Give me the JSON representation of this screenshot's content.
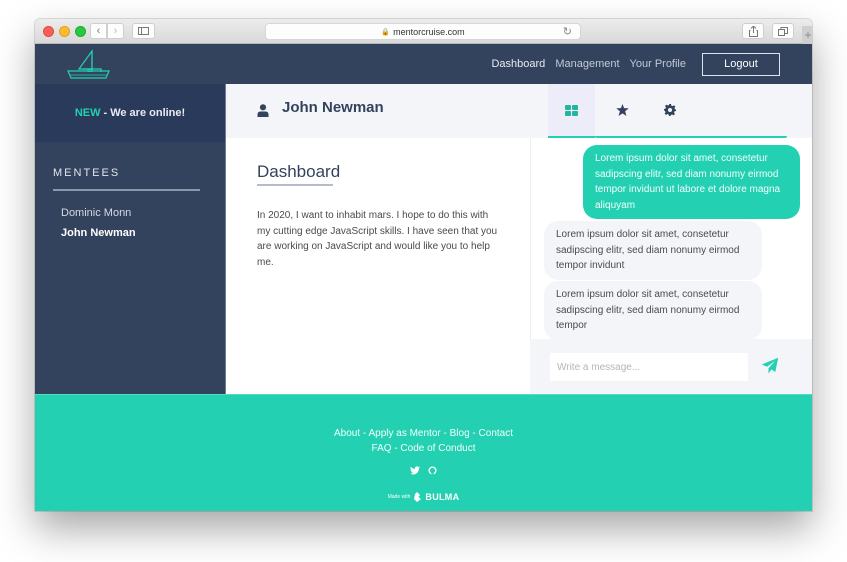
{
  "browser": {
    "url": "mentorcruise.com",
    "icons": [
      "back-icon",
      "forward-icon",
      "sidebar-icon",
      "lock-icon",
      "reload-icon",
      "share-icon",
      "tabs-icon",
      "new-tab-icon"
    ]
  },
  "navbar": {
    "logo": "sailboat-logo",
    "links": [
      "Dashboard",
      "Management",
      "Your Profile"
    ],
    "logout_label": "Logout"
  },
  "sidebar": {
    "banner_new": "NEW",
    "banner_text": " - We are online!",
    "section_title": "MENTEES",
    "mentees": [
      "Dominic Monn",
      "John Newman"
    ],
    "active_mentee": "John Newman"
  },
  "main": {
    "user_name": "John Newman",
    "section_title": "Dashboard",
    "description": "In 2020, I want to inhabit mars. I hope to do this with my cutting edge JavaScript skills. I have seen that you are working on JavaScript and would like you to help me."
  },
  "chat": {
    "tabs": [
      {
        "icon": "dashboard-icon",
        "active": true
      },
      {
        "icon": "star-icon",
        "active": false
      },
      {
        "icon": "gear-icon",
        "active": false
      }
    ],
    "messages": [
      {
        "direction": "outgoing",
        "text": "Lorem ipsum dolor sit amet, consetetur sadipscing elitr, sed diam nonumy eirmod tempor invidunt ut labore et dolore magna aliquyam"
      },
      {
        "direction": "incoming",
        "text": "Lorem ipsum dolor sit amet, consetetur sadipscing elitr, sed diam nonumy eirmod tempor invidunt"
      },
      {
        "direction": "incoming",
        "text": "Lorem ipsum dolor sit amet, consetetur sadipscing elitr, sed diam nonumy eirmod tempor"
      }
    ],
    "input_placeholder": "Write a message...",
    "input_value": ""
  },
  "footer": {
    "links_row1": [
      "About",
      "Apply as Mentor",
      "Blog",
      "Contact"
    ],
    "links_row2": [
      "FAQ",
      "Code of Conduct"
    ],
    "separator": " - ",
    "social": [
      "twitter-icon",
      "github-icon"
    ],
    "made_with": "Made with",
    "bulma": "BULMA"
  },
  "colors": {
    "primary": "#23d1b2",
    "navbar": "#34435d",
    "sidebar_banner": "#293a5a",
    "panel_bg": "#f4f5f9"
  }
}
